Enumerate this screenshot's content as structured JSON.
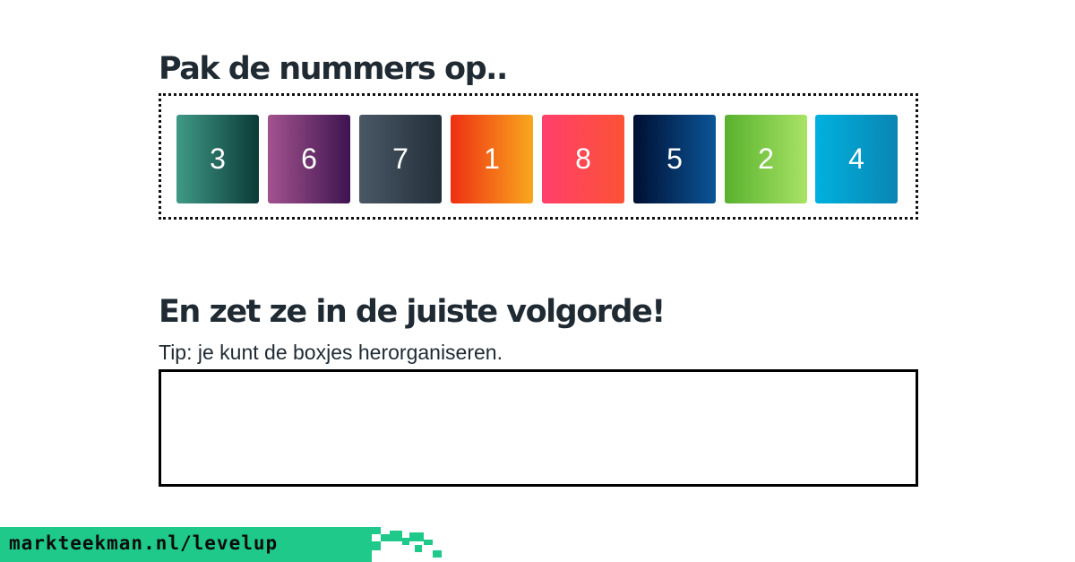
{
  "heading_pick": "Pak de nummers op..",
  "heading_order": "En zet ze in de juiste volgorde!",
  "tip": "Tip: je kunt de boxjes herorganiseren.",
  "tiles": [
    {
      "label": "3",
      "color_from": "#3f9a86",
      "color_to": "#0b3a37"
    },
    {
      "label": "6",
      "color_from": "#a2538e",
      "color_to": "#3e1451"
    },
    {
      "label": "7",
      "color_from": "#4a5866",
      "color_to": "#23303a"
    },
    {
      "label": "1",
      "color_from": "#ef2f13",
      "color_to": "#f8a81d"
    },
    {
      "label": "8",
      "color_from": "#ff3f6c",
      "color_to": "#fc5235"
    },
    {
      "label": "5",
      "color_from": "#000f32",
      "color_to": "#0b5597"
    },
    {
      "label": "2",
      "color_from": "#58b12e",
      "color_to": "#a9e365"
    },
    {
      "label": "4",
      "color_from": "#00b1df",
      "color_to": "#0a85b2"
    }
  ],
  "footer": {
    "url": "markteekman.nl/levelup",
    "accent_color": "#1ec98a"
  }
}
